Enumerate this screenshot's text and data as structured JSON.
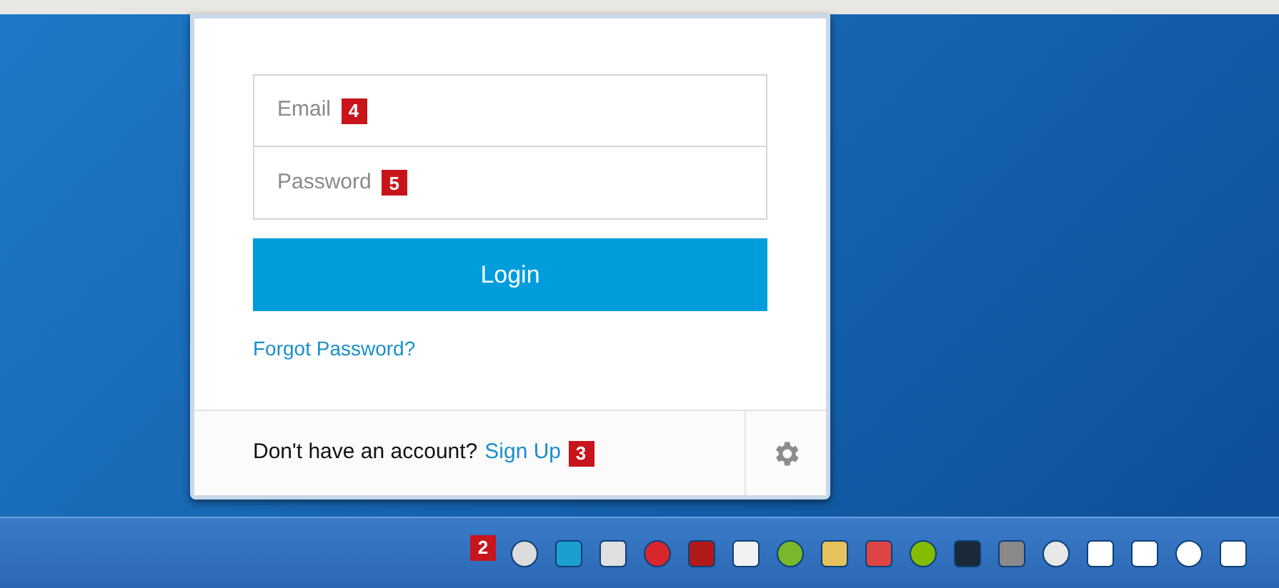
{
  "login_panel": {
    "email_field": {
      "placeholder": "Email",
      "marker": "4"
    },
    "password_field": {
      "placeholder": "Password",
      "marker": "5"
    },
    "login_button": "Login",
    "forgot_link": "Forgot Password?",
    "footer": {
      "text": "Don't have an account?",
      "link": "Sign Up",
      "marker": "3"
    }
  },
  "taskbar": {
    "marker": "2"
  }
}
